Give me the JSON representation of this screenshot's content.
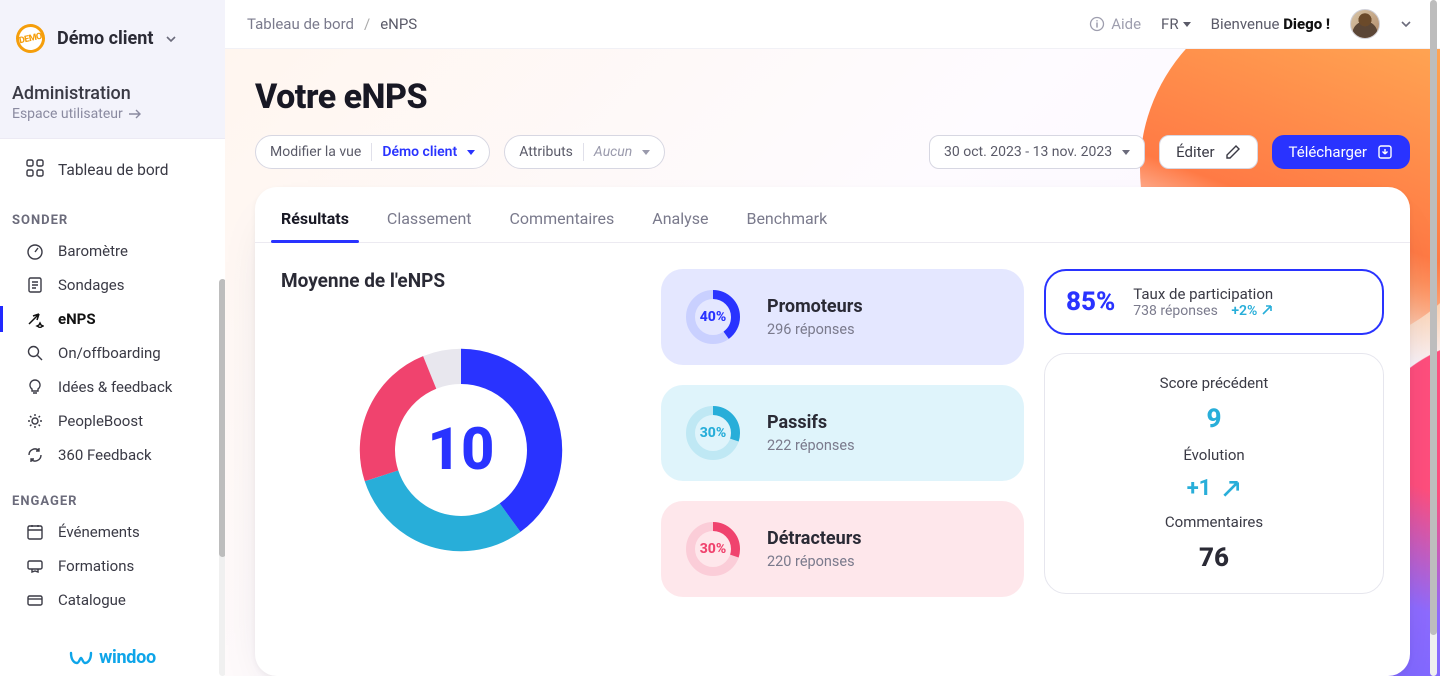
{
  "org": {
    "name": "Démo client",
    "badge_text": "DEMO"
  },
  "admin": {
    "title": "Administration",
    "subtitle": "Espace utilisateur"
  },
  "nav": {
    "dashboard": "Tableau de bord",
    "group1_title": "SONDER",
    "group1": [
      "Baromètre",
      "Sondages",
      "eNPS",
      "On/offboarding",
      "Idées & feedback",
      "PeopleBoost",
      "360 Feedback"
    ],
    "group2_title": "ENGAGER",
    "group2": [
      "Événements",
      "Formations",
      "Catalogue"
    ]
  },
  "brand": "windoo",
  "breadcrumb": {
    "root": "Tableau de bord",
    "current": "eNPS"
  },
  "topbar": {
    "help": "Aide",
    "lang": "FR",
    "welcome_prefix": "Bienvenue ",
    "welcome_user": "Diego !"
  },
  "page": {
    "title": "Votre eNPS"
  },
  "controls": {
    "modify_label": "Modifier la vue",
    "modify_value": "Démo client",
    "attr_label": "Attributs",
    "attr_value": "Aucun",
    "daterange": "30 oct. 2023 - 13 nov. 2023",
    "edit": "Éditer",
    "download": "Télécharger"
  },
  "tabs": [
    "Résultats",
    "Classement",
    "Commentaires",
    "Analyse",
    "Benchmark"
  ],
  "enps": {
    "title": "Moyenne de l'eNPS",
    "score": "10",
    "promoters": {
      "label": "Promoteurs",
      "pct": "40%",
      "responses": "296 réponses"
    },
    "passives": {
      "label": "Passifs",
      "pct": "30%",
      "responses": "222 réponses"
    },
    "detractors": {
      "label": "Détracteurs",
      "pct": "30%",
      "responses": "220 réponses"
    }
  },
  "participation": {
    "pct": "85%",
    "label": "Taux de participation",
    "sub": "738 réponses",
    "delta": "+2%"
  },
  "stats": {
    "prev_label": "Score précédent",
    "prev_value": "9",
    "evo_label": "Évolution",
    "evo_value": "+1",
    "comments_label": "Commentaires",
    "comments_value": "76"
  },
  "chart_data": {
    "type": "pie",
    "title": "Moyenne de l'eNPS",
    "categories": [
      "Promoteurs",
      "Passifs",
      "Détracteurs",
      "(reste)"
    ],
    "values": [
      40,
      30,
      30,
      null
    ],
    "series": [
      {
        "name": "Promoteurs",
        "value": 40,
        "responses": 296,
        "color": "#2933ff"
      },
      {
        "name": "Passifs",
        "value": 30,
        "responses": 222,
        "color": "#28aed9"
      },
      {
        "name": "Détracteurs",
        "value": 30,
        "responses": 220,
        "color": "#f0436e"
      }
    ],
    "center_value": 10
  }
}
